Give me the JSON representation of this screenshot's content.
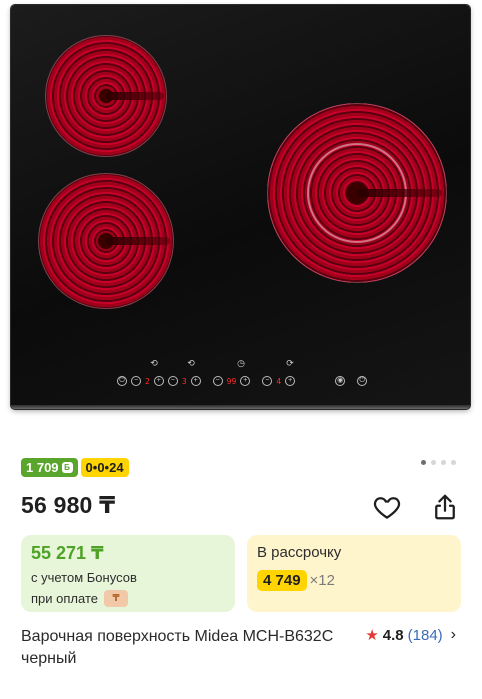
{
  "product_image": {
    "alt_icon": "cooktop-image",
    "gallery_dots": {
      "count": 4,
      "active_index": 0
    },
    "panel": {
      "top_icons": [
        "⟲",
        "⟲",
        "◷",
        "⟳"
      ],
      "led_1": "2",
      "led_2": "3",
      "led_3": "99",
      "led_4": "4"
    }
  },
  "badges": {
    "bonus": "1 709",
    "bonus_icon": "bonus-currency-icon",
    "installment": "0•0•24"
  },
  "price": {
    "main": "56 980 ₸"
  },
  "bonus_card": {
    "price": "55 271 ₸",
    "line1": "с учетом Бонусов",
    "line2": "при оплате"
  },
  "installment_card": {
    "label": "В рассрочку",
    "amount": "4 749",
    "multiplier": "×12"
  },
  "product": {
    "title": "Варочная поверхность Midea MCH-B632C черный"
  },
  "rating": {
    "value": "4.8",
    "count": "(184)"
  },
  "colors": {
    "bonus_green": "#5aa52c",
    "installment_yellow": "#ffd400",
    "rating_star": "#e53935",
    "link_blue": "#3a6bb8"
  }
}
